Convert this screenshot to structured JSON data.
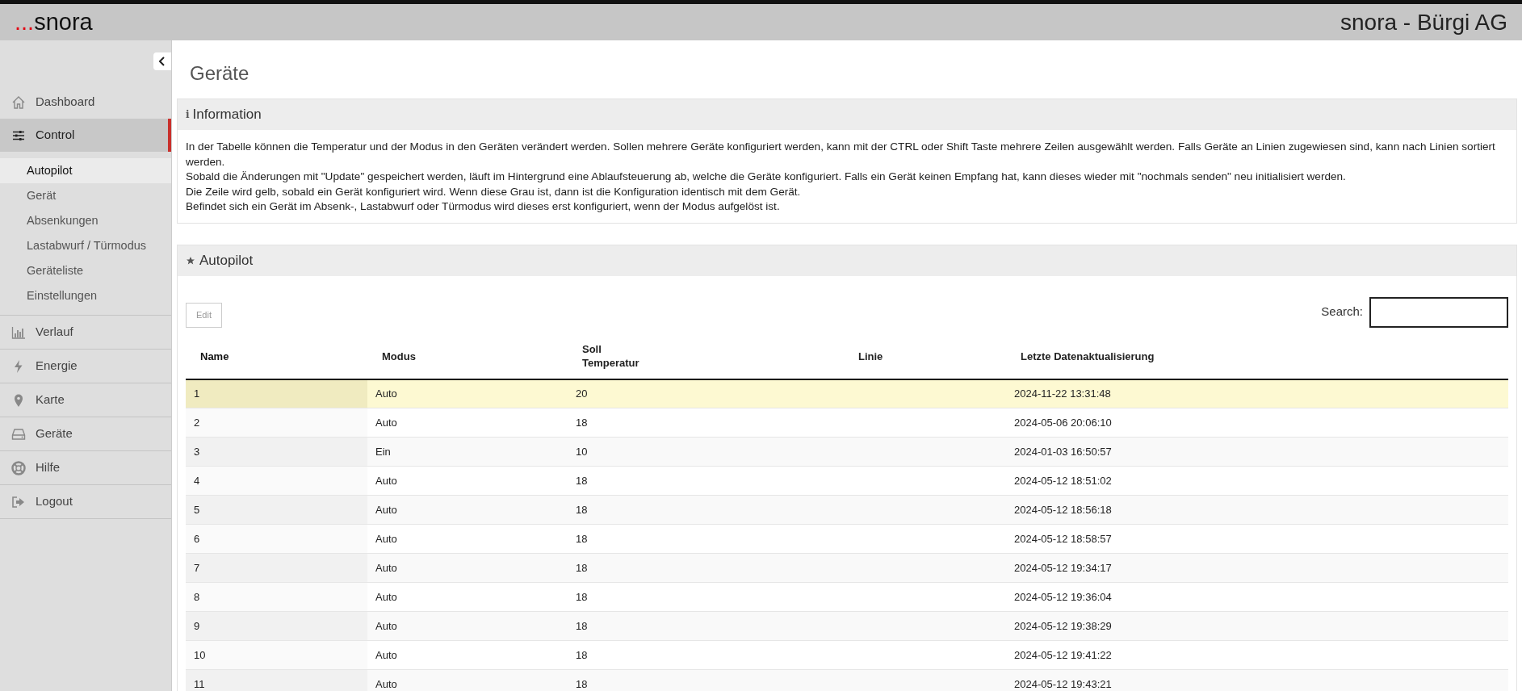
{
  "header": {
    "logo_dots": "...",
    "logo_text": "snora",
    "title": "snora - Bürgi AG"
  },
  "sidebar": {
    "items": [
      {
        "label": "Dashboard",
        "selected": false
      },
      {
        "label": "Control",
        "selected": true,
        "children": [
          {
            "label": "Autopilot",
            "selected": true
          },
          {
            "label": "Gerät",
            "selected": false
          },
          {
            "label": "Absenkungen",
            "selected": false
          },
          {
            "label": "Lastabwurf / Türmodus",
            "selected": false
          },
          {
            "label": "Geräteliste",
            "selected": false
          },
          {
            "label": "Einstellungen",
            "selected": false
          }
        ]
      },
      {
        "label": "Verlauf",
        "selected": false
      },
      {
        "label": "Energie",
        "selected": false
      },
      {
        "label": "Karte",
        "selected": false
      },
      {
        "label": "Geräte",
        "selected": false
      },
      {
        "label": "Hilfe",
        "selected": false
      },
      {
        "label": "Logout",
        "selected": false
      }
    ]
  },
  "page_title": "Geräte",
  "info_panel": {
    "icon": "i",
    "title": "Information",
    "lines": [
      "In der Tabelle können die Temperatur und der Modus in den Geräten verändert werden. Sollen mehrere Geräte konfiguriert werden, kann mit der CTRL oder Shift Taste mehrere Zeilen ausgewählt werden. Falls Geräte an Linien zugewiesen sind, kann nach Linien sortiert werden.",
      "Sobald die Änderungen mit \"Update\" gespeichert werden, läuft im Hintergrund eine Ablaufsteuerung ab, welche die Geräte konfiguriert. Falls ein Gerät keinen Empfang hat, kann dieses wieder mit \"nochmals senden\" neu initialisiert werden.",
      "Die Zeile wird gelb, sobald ein Gerät konfiguriert wird. Wenn diese Grau ist, dann ist die Konfiguration identisch mit dem Gerät.",
      "Befindet sich ein Gerät im Absenk-, Lastabwurf oder Türmodus wird dieses erst konfiguriert, wenn der Modus aufgelöst ist."
    ]
  },
  "autopilot_panel": {
    "title": "Autopilot",
    "edit_button": {
      "label": "Edit",
      "disabled": true
    },
    "search": {
      "label": "Search:"
    },
    "table": {
      "columns": [
        {
          "label": "Name",
          "sorted": true
        },
        {
          "label": "Modus",
          "sorted": false
        },
        {
          "label": "Soll\nTemperatur",
          "sorted": false
        },
        {
          "label": "Linie",
          "sorted": false
        },
        {
          "label": "Letzte Datenaktualisierung",
          "sorted": false
        }
      ],
      "rows": [
        {
          "cells": [
            "1",
            "Auto",
            "20",
            "",
            "2024-11-22 13:31:48"
          ],
          "configuring": true
        },
        {
          "cells": [
            "2",
            "Auto",
            "18",
            "",
            "2024-05-06 20:06:10"
          ],
          "configuring": false
        },
        {
          "cells": [
            "3",
            "Ein",
            "10",
            "",
            "2024-01-03 16:50:57"
          ],
          "configuring": false
        },
        {
          "cells": [
            "4",
            "Auto",
            "18",
            "",
            "2024-05-12 18:51:02"
          ],
          "configuring": false
        },
        {
          "cells": [
            "5",
            "Auto",
            "18",
            "",
            "2024-05-12 18:56:18"
          ],
          "configuring": false
        },
        {
          "cells": [
            "6",
            "Auto",
            "18",
            "",
            "2024-05-12 18:58:57"
          ],
          "configuring": false
        },
        {
          "cells": [
            "7",
            "Auto",
            "18",
            "",
            "2024-05-12 19:34:17"
          ],
          "configuring": false
        },
        {
          "cells": [
            "8",
            "Auto",
            "18",
            "",
            "2024-05-12 19:36:04"
          ],
          "configuring": false
        },
        {
          "cells": [
            "9",
            "Auto",
            "18",
            "",
            "2024-05-12 19:38:29"
          ],
          "configuring": false
        },
        {
          "cells": [
            "10",
            "Auto",
            "18",
            "",
            "2024-05-12 19:41:22"
          ],
          "configuring": false
        },
        {
          "cells": [
            "11",
            "Auto",
            "18",
            "",
            "2024-05-12 19:43:21"
          ],
          "configuring": false
        }
      ]
    }
  }
}
